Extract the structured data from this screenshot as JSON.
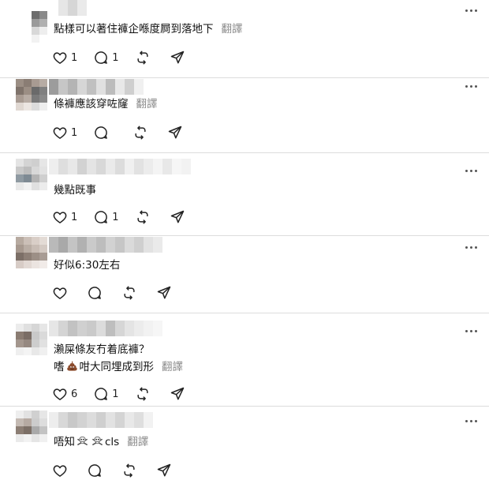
{
  "translate_label": "翻譯",
  "colors": {
    "separator": "#dcdcdc",
    "icon": "#222222",
    "muted": "#8a8a8a"
  },
  "posts": [
    {
      "lines": [
        "點樣可以著住褲企喺度屙到落地下"
      ],
      "likes": "1",
      "replies": "1"
    },
    {
      "lines": [
        "條褲應該穿咗窿"
      ],
      "likes": "1",
      "replies": ""
    },
    {
      "lines": [
        "幾點既事"
      ],
      "likes": "1",
      "replies": "1"
    },
    {
      "lines": [
        "好似6:30左右"
      ],
      "likes": "",
      "replies": ""
    },
    {
      "lines": [
        "瀨屎條友冇着底褲？",
        "嗜",
        "咁大同埋成到形"
      ],
      "likes": "6",
      "replies": "1"
    },
    {
      "lines": [
        "唔知",
        "cls"
      ],
      "likes": "",
      "replies": ""
    }
  ],
  "icons": [
    "heart-icon",
    "reply-icon",
    "repost-icon",
    "share-icon",
    "more-icon",
    "poop-emoji",
    "skull-crossbones-emoji"
  ]
}
